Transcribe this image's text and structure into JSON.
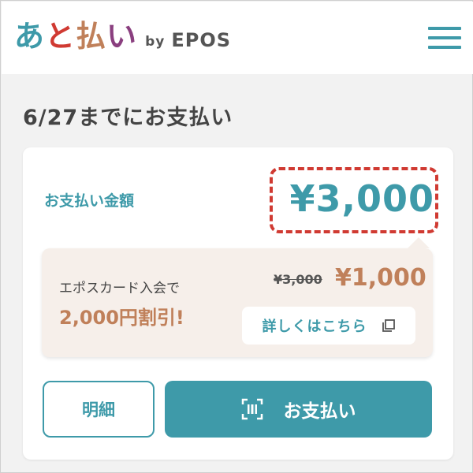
{
  "header": {
    "logo": {
      "chars": [
        {
          "text": "あ",
          "color": "#3e9aa9"
        },
        {
          "text": "と",
          "color": "#d03a32"
        },
        {
          "text": "払",
          "color": "#c0805a"
        },
        {
          "text": "い",
          "color": "#8a3f7f"
        }
      ],
      "by": "by",
      "brand": "EPOS"
    },
    "menu_icon": "hamburger-menu-icon"
  },
  "due_text": "6/27までにお支払い",
  "card": {
    "amount_label": "お支払い金額",
    "amount": "¥3,000",
    "promo": {
      "line1": "エポスカード入会で",
      "line2": "2,000円割引!",
      "old_price": "¥3,000",
      "new_price": "¥1,000",
      "details_label": "詳しくはこちら",
      "details_icon": "external-window-icon"
    },
    "detail_button": "明細",
    "pay_button": "お支払い",
    "pay_icon": "scan-code-icon"
  },
  "colors": {
    "accent": "#3e9aa9",
    "promo_text": "#c0805a",
    "highlight": "#d03a32",
    "promo_bg": "#f6efea"
  }
}
